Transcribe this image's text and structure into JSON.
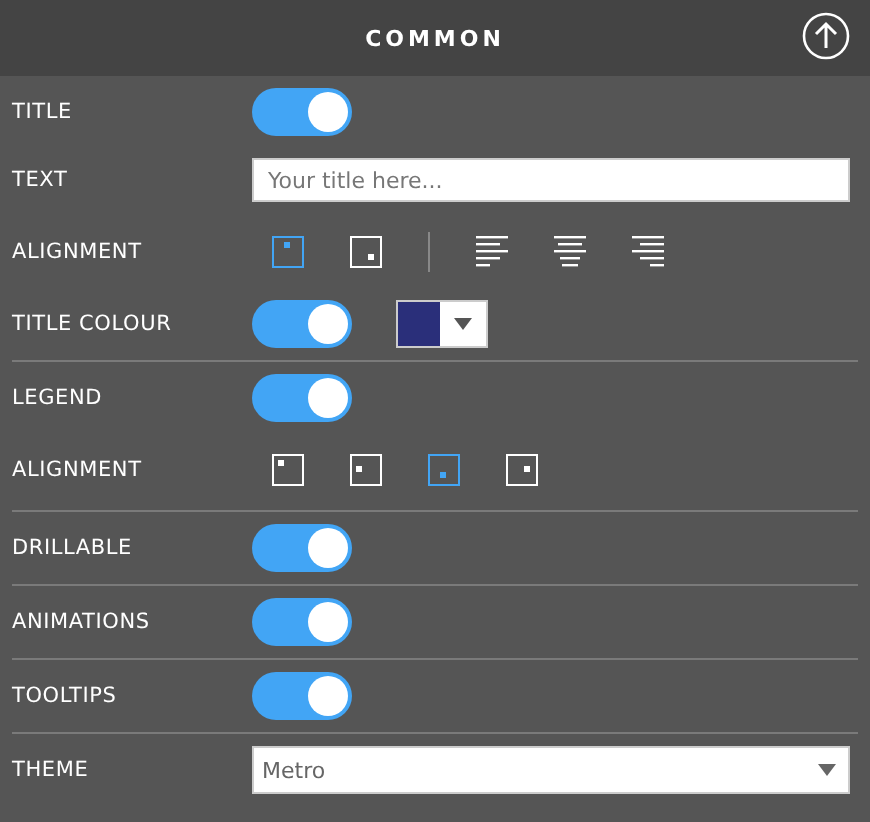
{
  "header": {
    "title": "COMMON"
  },
  "groups": [
    {
      "rows": [
        {
          "kind": "toggle",
          "label": "TITLE",
          "on": true
        },
        {
          "kind": "text",
          "label": "TEXT",
          "placeholder": "Your title here..."
        },
        {
          "kind": "alignment",
          "label": "ALIGNMENT",
          "options": [
            {
              "kind": "top-center",
              "selected": true
            },
            {
              "kind": "bottom-right",
              "selected": false
            },
            {
              "kind": "separator"
            },
            {
              "kind": "text-left",
              "selected": false
            },
            {
              "kind": "text-center",
              "selected": false
            },
            {
              "kind": "text-right",
              "selected": false
            }
          ]
        },
        {
          "kind": "toggle-color",
          "label": "TITLE COLOUR",
          "on": true,
          "color": "#2a2f7a"
        }
      ]
    },
    {
      "rows": [
        {
          "kind": "toggle",
          "label": "LEGEND",
          "on": true
        },
        {
          "kind": "alignment",
          "label": "ALIGNMENT",
          "options": [
            {
              "kind": "top-left",
              "selected": false
            },
            {
              "kind": "middle-left",
              "selected": false
            },
            {
              "kind": "bottom-center",
              "selected": true
            },
            {
              "kind": "middle-right",
              "selected": false
            }
          ]
        }
      ]
    },
    {
      "rows": [
        {
          "kind": "toggle",
          "label": "DRILLABLE",
          "on": true
        }
      ]
    },
    {
      "rows": [
        {
          "kind": "toggle",
          "label": "ANIMATIONS",
          "on": true
        }
      ]
    },
    {
      "rows": [
        {
          "kind": "toggle",
          "label": "TOOLTIPS",
          "on": true
        }
      ]
    },
    {
      "rows": [
        {
          "kind": "select",
          "label": "THEME",
          "value": "Metro"
        }
      ]
    }
  ]
}
